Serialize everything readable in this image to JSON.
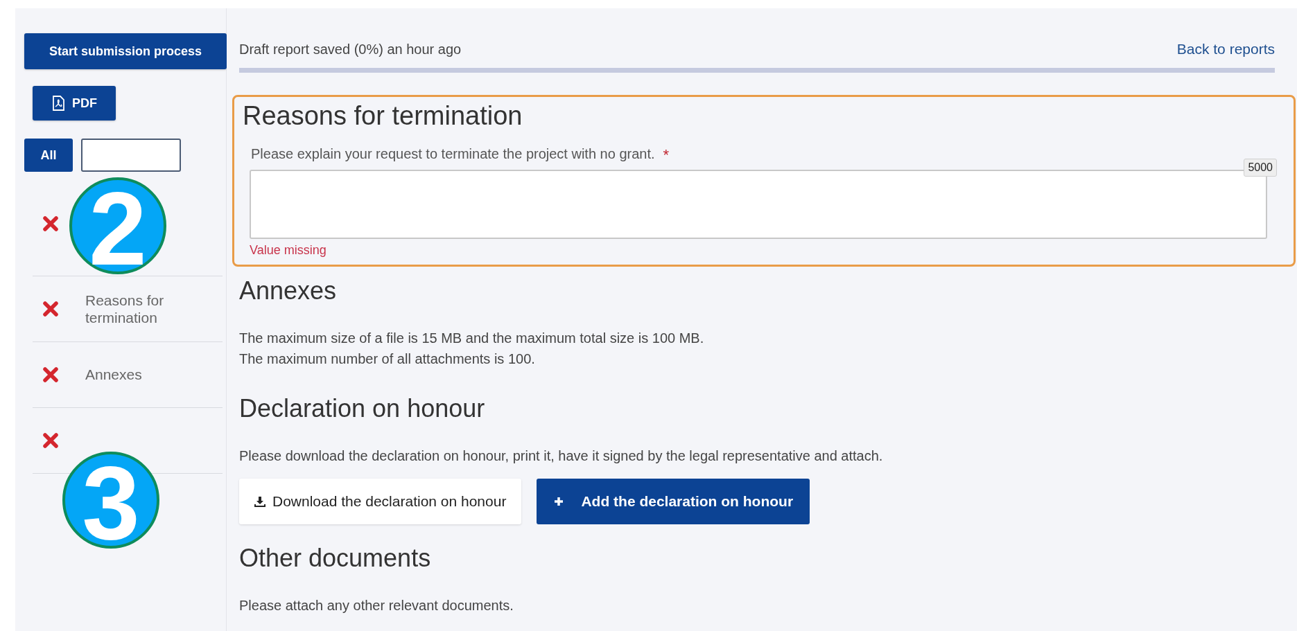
{
  "sidebar": {
    "submit_button": "Start submission process",
    "pdf_button": "PDF",
    "filters": [
      {
        "label": "All",
        "selected": true
      },
      {
        "selected": false
      }
    ],
    "items": [
      {
        "error": true
      },
      {
        "label": "Reasons for termination",
        "error": true
      },
      {
        "label": "Annexes",
        "error": true
      },
      {
        "error": true
      }
    ]
  },
  "header": {
    "status": "Draft report saved (0%) an hour ago",
    "back_link": "Back to reports"
  },
  "sections": [
    {
      "kind": "question",
      "title": "Reasons for termination",
      "invalid": true,
      "question": "Please explain your request to terminate the project with no grant.",
      "required_mark": "*",
      "char_limit": "5000",
      "error": "Value missing"
    },
    {
      "kind": "info",
      "title": "Annexes",
      "lines": [
        "The maximum size of a file is 15 MB and the maximum total size is 100 MB.",
        "The maximum number of all attachments is 100."
      ]
    },
    {
      "kind": "declaration",
      "title": "Declaration on honour",
      "text": "Please download the declaration on honour, print it, have it signed by the legal representative and attach.",
      "download_button": "Download the declaration on honour",
      "add_button": "Add the declaration on honour"
    },
    {
      "kind": "info",
      "title": "Other documents",
      "lines": [
        "Please attach any other relevant documents."
      ]
    }
  ],
  "markers": [
    {
      "number": "2"
    },
    {
      "number": "3"
    }
  ]
}
